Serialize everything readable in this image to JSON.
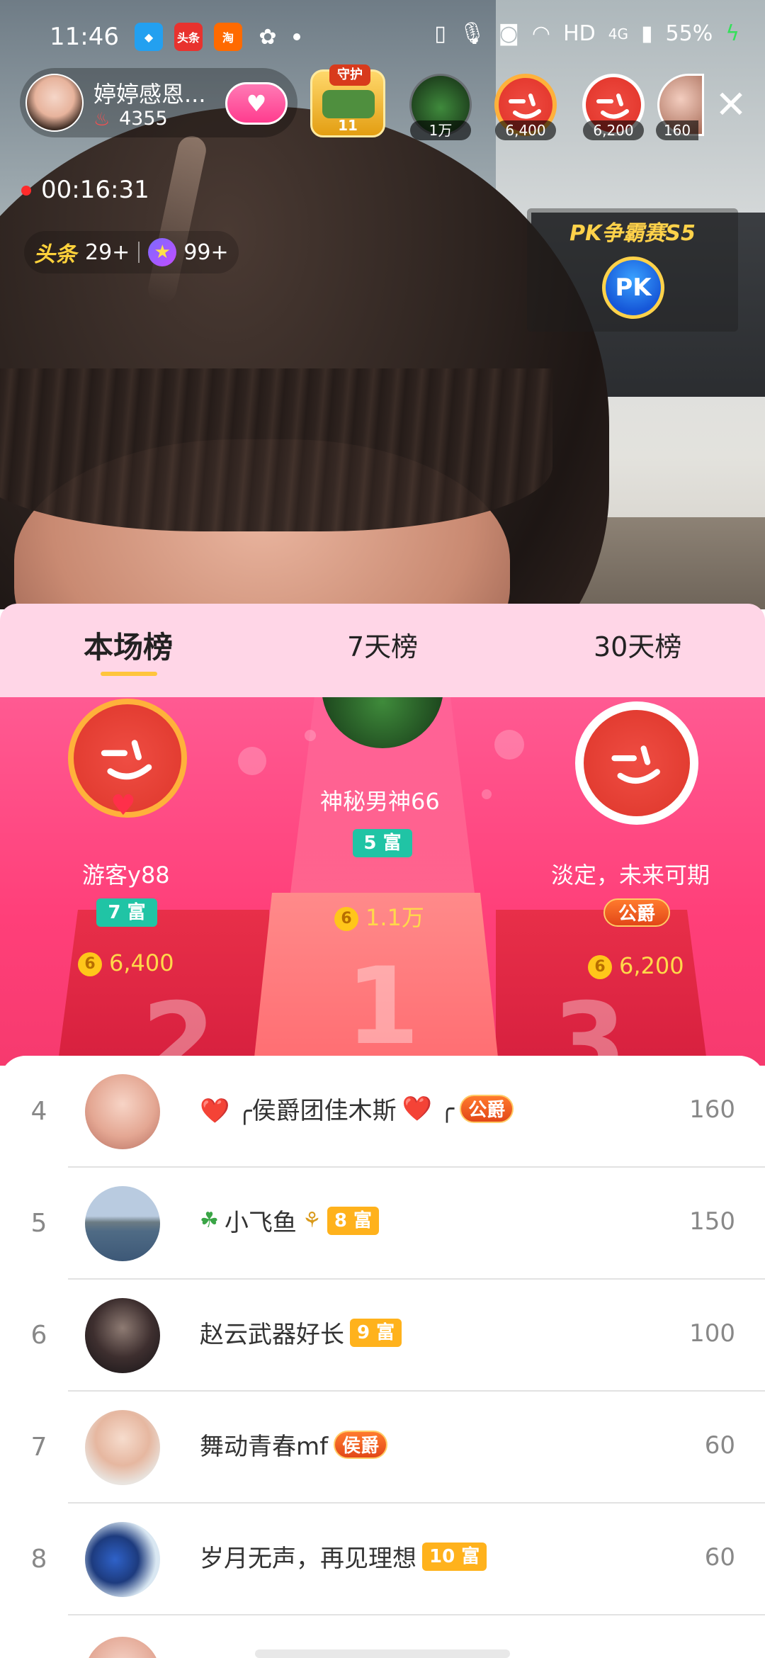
{
  "status_bar": {
    "time": "11:46",
    "network": "HD",
    "signal": "4G",
    "battery": "55%"
  },
  "status_apps": [
    {
      "name": "qq-icon",
      "label": "",
      "color": "#23a0f0"
    },
    {
      "name": "toutiao-app-icon",
      "label": "头条",
      "color": "#e8322e"
    },
    {
      "name": "taobao-app-icon",
      "label": "淘",
      "color": "#ff6a00"
    },
    {
      "name": "wechat-icon",
      "label": "",
      "color": "#ffffff"
    }
  ],
  "host": {
    "name": "婷婷感恩...",
    "heat": "4355"
  },
  "guard": {
    "label": "守护",
    "count": "11"
  },
  "top_viewers": [
    {
      "label": "1万"
    },
    {
      "label": "6,400"
    },
    {
      "label": "6,200"
    },
    {
      "label": "160"
    }
  ],
  "live": {
    "duration": "00:16:31"
  },
  "tags": {
    "toutiao": "头条",
    "toutiao_count": "29+",
    "star_count": "99+"
  },
  "pk": {
    "title": "PK争霸赛S5",
    "button": "PK"
  },
  "tabs": [
    "本场榜",
    "7天榜",
    "30天榜"
  ],
  "podium": {
    "first": {
      "name": "神秘男神66",
      "badge": "5 富",
      "score": "1.1万"
    },
    "second": {
      "name": "游客y88",
      "badge": "7 富",
      "score": "6,400"
    },
    "third": {
      "name": "淡定，未来可期",
      "badge": "公爵",
      "score": "6,200"
    },
    "numbers": {
      "one": "1",
      "two": "2",
      "three": "3"
    }
  },
  "rows": [
    {
      "rank": "4",
      "pre": "❤️ ╭侯爵团佳木斯",
      "post": "❤️ ╭",
      "badge": "公爵",
      "badge_type": "duke",
      "score": "160"
    },
    {
      "rank": "5",
      "pre": "小飞鱼",
      "post": "",
      "badge": "8 富",
      "badge_type": "rich",
      "score": "150"
    },
    {
      "rank": "6",
      "pre": "赵云武器好长",
      "post": "",
      "badge": "9 富",
      "badge_type": "rich",
      "score": "100"
    },
    {
      "rank": "7",
      "pre": "舞动青春mf",
      "post": "",
      "badge": "侯爵",
      "badge_type": "duke",
      "score": "60"
    },
    {
      "rank": "8",
      "pre": "岁月无声，再见理想",
      "post": "",
      "badge": "10 富",
      "badge_type": "rich",
      "score": "60"
    }
  ]
}
